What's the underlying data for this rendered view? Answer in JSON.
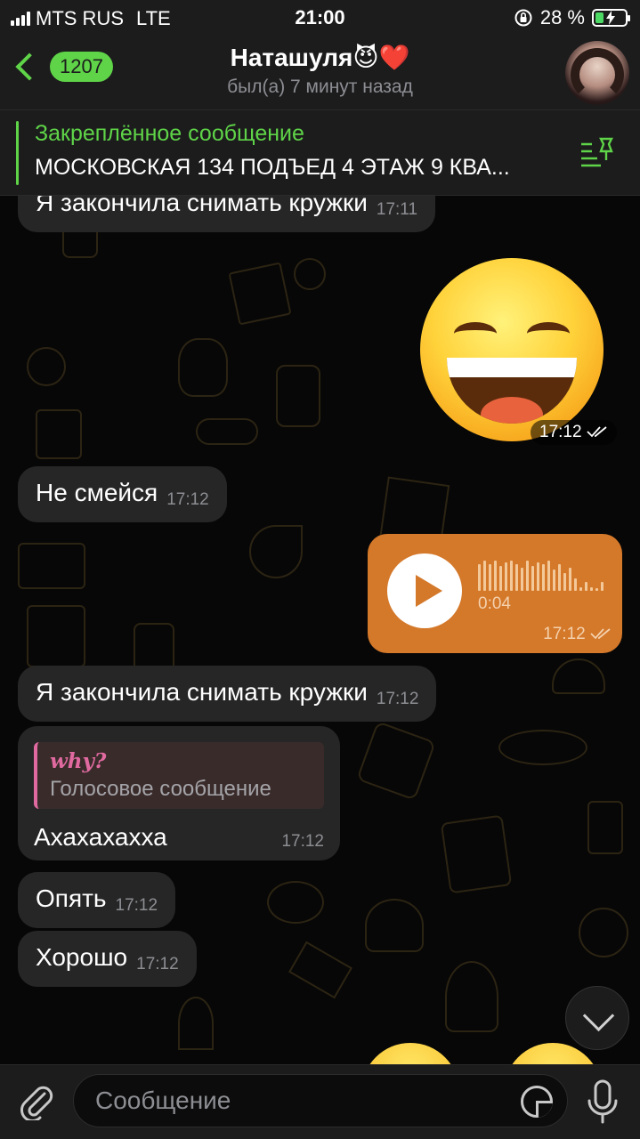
{
  "status_bar": {
    "carrier": "MTS RUS",
    "network": "LTE",
    "time": "21:00",
    "battery": "28 %",
    "battery_level": 0.28,
    "icons": [
      "signal-icon",
      "orientation-lock-icon",
      "battery-charging-icon"
    ]
  },
  "header": {
    "back_count": "1207",
    "title": "Наташуля😈❤️",
    "subtitle": "был(а) 7 минут назад",
    "icons": [
      "back-chevron-icon",
      "avatar"
    ]
  },
  "pinned": {
    "label": "Закреплённое сообщение",
    "text": "МОСКОВСКАЯ 134 ПОДЪЕД 4 ЭТАЖ 9 КВА...",
    "icon": "pin-list-icon"
  },
  "messages": [
    {
      "type": "text",
      "direction": "in",
      "text": "Я закончила снимать кружки",
      "time": "17:11"
    },
    {
      "type": "sticker",
      "direction": "out",
      "emoji": "😄",
      "time": "17:12",
      "status": "read"
    },
    {
      "type": "text",
      "direction": "in",
      "text": "Не смейся",
      "time": "17:12"
    },
    {
      "type": "voice",
      "direction": "out",
      "duration": "0:04",
      "time": "17:12",
      "status": "read"
    },
    {
      "type": "text",
      "direction": "in",
      "text": "Я закончила снимать кружки",
      "time": "17:12"
    },
    {
      "type": "reply",
      "direction": "in",
      "reply_name": "why?",
      "reply_text": "Голосовое сообщение",
      "text": "Ахахахахха",
      "time": "17:12"
    },
    {
      "type": "text",
      "direction": "in",
      "text": "Опять",
      "time": "17:12"
    },
    {
      "type": "text",
      "direction": "in",
      "text": "Хорошо",
      "time": "17:12"
    }
  ],
  "input": {
    "placeholder": "Сообщение",
    "value": "",
    "icons": [
      "paperclip-icon",
      "sticker-icon",
      "microphone-icon"
    ]
  },
  "colors": {
    "accent": "#5fd448",
    "outgoing_bubble": "#d4782a",
    "incoming_bubble": "#262626",
    "reply_accent": "#e06aa0",
    "bar_bg": "#1c1c1d"
  }
}
